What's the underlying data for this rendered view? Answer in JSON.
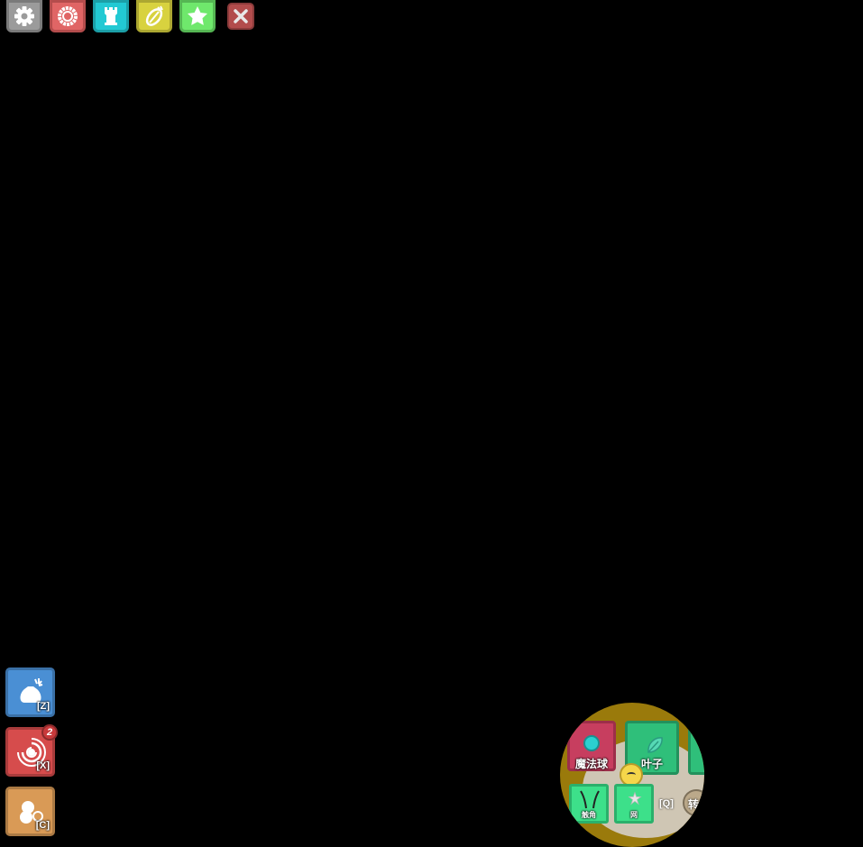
{
  "toolbar": {
    "buttons": [
      {
        "name": "settings-button",
        "icon": "gear-icon",
        "color": "#9b9b9b",
        "border": "#7a7a7a"
      },
      {
        "name": "petals-button",
        "icon": "ring-icon",
        "color": "#e06565",
        "border": "#b44c4c"
      },
      {
        "name": "tower-button",
        "icon": "rook-icon",
        "color": "#22c9d3",
        "border": "#1b9fa7"
      },
      {
        "name": "crafting-button",
        "icon": "bean-icon",
        "color": "#d8d23f",
        "border": "#aca731"
      },
      {
        "name": "favorites-button",
        "icon": "star-icon",
        "color": "#6fe86c",
        "border": "#55b653"
      }
    ],
    "close": {
      "icon": "close-icon",
      "color": "#b24c4c"
    }
  },
  "side_buttons": [
    {
      "name": "inventory-button",
      "icon": "sack-icon",
      "key": "[Z]",
      "color": "#4a8fd4",
      "border": "#3a70a6"
    },
    {
      "name": "mob-gallery-button",
      "icon": "swirl-icon",
      "key": "[X]",
      "badge": "2",
      "color": "#d64c4c",
      "border": "#a83b3b"
    },
    {
      "name": "craft-button",
      "icon": "bubbles-icon",
      "key": "[C]",
      "color": "#d99a56",
      "border": "#ab7a44"
    }
  ],
  "minimap": {
    "slots": [
      {
        "label": "魔法球",
        "icon": "orb-icon"
      },
      {
        "label": "叶子",
        "icon": "leaf-icon"
      },
      {
        "label": "触角",
        "icon": "antennae-icon"
      },
      {
        "label": "网",
        "icon": "web-icon"
      }
    ],
    "swap_key": "[Q]",
    "swap_label": "转"
  }
}
